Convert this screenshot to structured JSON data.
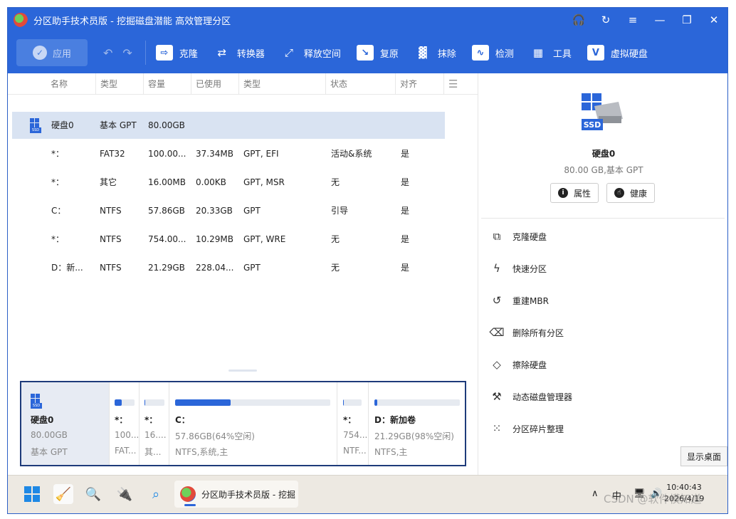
{
  "window": {
    "title": "分区助手技术员版 - 挖掘磁盘潜能 高效管理分区",
    "controls": [
      "headset-icon",
      "refresh-icon",
      "menu-icon",
      "minimize-icon",
      "restore-icon",
      "close-icon"
    ]
  },
  "toolbar": {
    "apply_label": "应用",
    "items": [
      {
        "label": "克隆",
        "icon": "clone-icon"
      },
      {
        "label": "转换器",
        "icon": "convert-icon"
      },
      {
        "label": "释放空间",
        "icon": "free-space-icon"
      },
      {
        "label": "复原",
        "icon": "recover-icon"
      },
      {
        "label": "抹除",
        "icon": "wipe-icon"
      },
      {
        "label": "检测",
        "icon": "monitor-icon"
      },
      {
        "label": "工具",
        "icon": "tools-icon"
      },
      {
        "label": "虚拟硬盘",
        "icon": "virtual-disk-icon"
      }
    ]
  },
  "table": {
    "headers": [
      "名称",
      "类型",
      "容量",
      "已使用",
      "类型",
      "状态",
      "对齐"
    ],
    "disk_row": {
      "name": "硬盘0",
      "type": "基本 GPT",
      "capacity": "80.00GB"
    },
    "rows": [
      {
        "name": "*：",
        "fs": "FAT32",
        "capacity": "100.00...",
        "used": "37.34MB",
        "type": "GPT, EFI",
        "status": "活动&系统",
        "align": "是"
      },
      {
        "name": "*：",
        "fs": "其它",
        "capacity": "16.00MB",
        "used": "0.00KB",
        "type": "GPT, MSR",
        "status": "无",
        "align": "是"
      },
      {
        "name": "C：",
        "fs": "NTFS",
        "capacity": "57.86GB",
        "used": "20.33GB",
        "type": "GPT",
        "status": "引导",
        "align": "是"
      },
      {
        "name": "*：",
        "fs": "NTFS",
        "capacity": "754.00...",
        "used": "10.29MB",
        "type": "GPT, WRE",
        "status": "无",
        "align": "是"
      },
      {
        "name": "D：新...",
        "fs": "NTFS",
        "capacity": "21.29GB",
        "used": "228.04...",
        "type": "GPT",
        "status": "无",
        "align": "是"
      }
    ]
  },
  "diskmap": {
    "disk": {
      "name": "硬盘0",
      "size": "80.00GB",
      "type": "基本 GPT"
    },
    "partitions": [
      {
        "name": "*：",
        "line2": "100...",
        "line3": "FAT...",
        "used_fraction": 0.37
      },
      {
        "name": "*：",
        "line2": "16....",
        "line3": "其...",
        "used_fraction": 0.0
      },
      {
        "name": "C：",
        "line2": "57.86GB(64%空闲)",
        "line3": "NTFS,系统,主",
        "used_fraction": 0.36
      },
      {
        "name": "*：",
        "line2": "754...",
        "line3": "NTF...",
        "used_fraction": 0.01
      },
      {
        "name": "D：新加卷",
        "line2": "21.29GB(98%空闲)",
        "line3": "NTFS,主",
        "used_fraction": 0.02
      }
    ]
  },
  "right_panel": {
    "disk_name": "硬盘0",
    "disk_sub": "80.00 GB,基本 GPT",
    "properties_label": "属性",
    "health_label": "健康",
    "operations": [
      {
        "label": "克隆硬盘",
        "icon": "clone-disk-icon"
      },
      {
        "label": "快速分区",
        "icon": "lightning-icon"
      },
      {
        "label": "重建MBR",
        "icon": "rebuild-icon"
      },
      {
        "label": "删除所有分区",
        "icon": "trash-icon"
      },
      {
        "label": "擦除硬盘",
        "icon": "eraser-icon"
      },
      {
        "label": "动态磁盘管理器",
        "icon": "wrench-icon"
      },
      {
        "label": "分区碎片整理",
        "icon": "defrag-icon"
      }
    ],
    "show_desktop": "显示桌面"
  },
  "taskbar": {
    "app_label": "分区助手技术员版 - 挖掘",
    "ime": "中",
    "time": "10:40:43",
    "date": "2026/4/19"
  },
  "watermark": "CSDN @软件模知道"
}
